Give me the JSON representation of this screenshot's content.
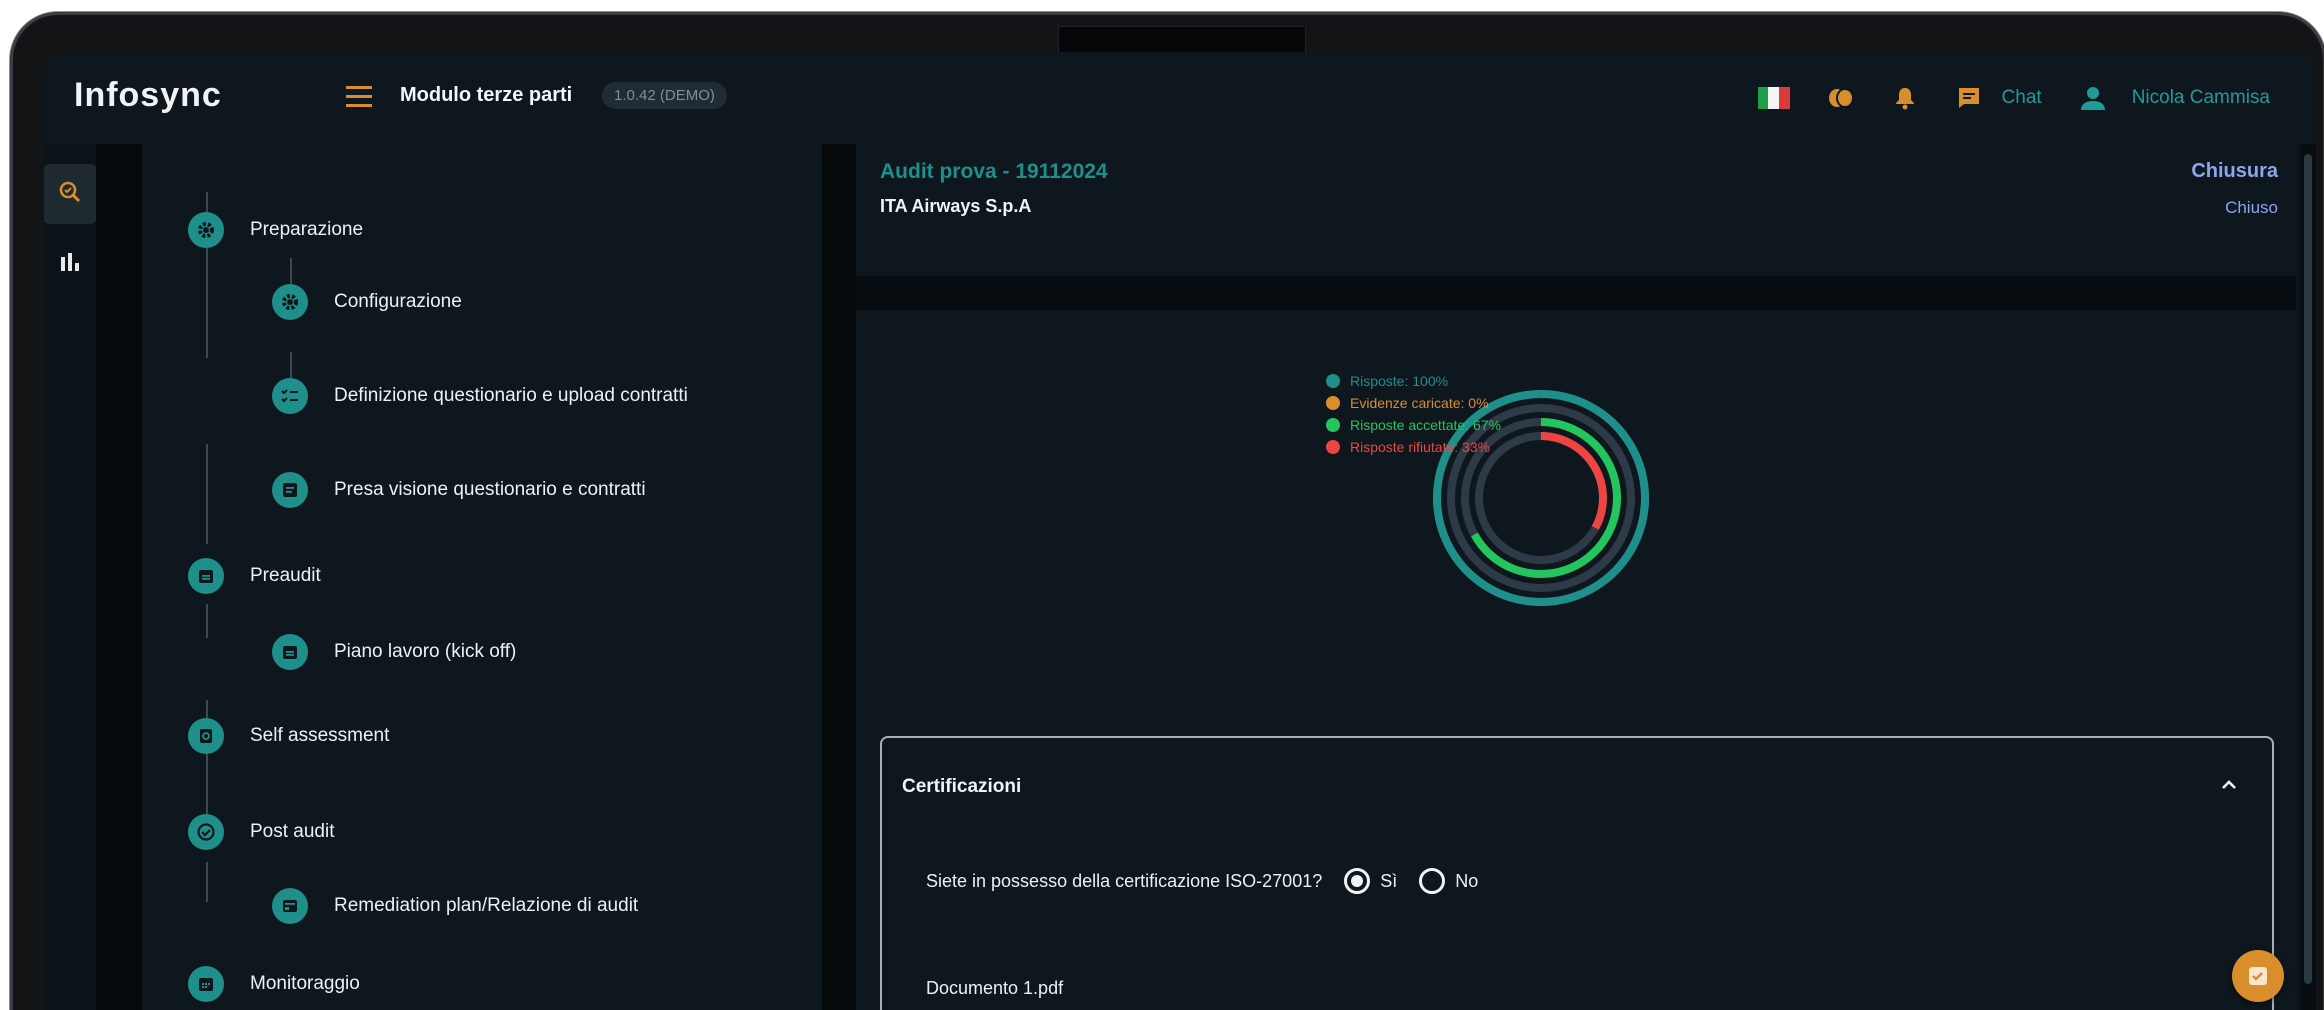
{
  "header": {
    "brand": "Infosync",
    "module_title": "Modulo terze parti",
    "version": "1.0.42 (DEMO)",
    "chat_label": "Chat",
    "user_name": "Nicola Cammisa",
    "accent": "#d98e2b",
    "teal": "#1f9c9a"
  },
  "rail": {
    "items": [
      {
        "icon": "audit-search-icon",
        "active": true
      },
      {
        "icon": "bar-chart-icon",
        "active": false
      }
    ]
  },
  "steps": {
    "items": [
      {
        "label": "Preparazione",
        "icon": "gear-icon",
        "level": 0
      },
      {
        "label": "Configurazione",
        "icon": "gear-icon",
        "level": 1
      },
      {
        "label": "Definizione questionario e upload contratti",
        "icon": "checklist-icon",
        "level": 1
      },
      {
        "label": "Presa visione questionario e contratti",
        "icon": "document-icon",
        "level": 1
      },
      {
        "label": "Preaudit",
        "icon": "calendar-icon",
        "level": 0
      },
      {
        "label": "Piano lavoro (kick off)",
        "icon": "calendar-icon",
        "level": 1
      },
      {
        "label": "Self assessment",
        "icon": "search-doc-icon",
        "level": 0
      },
      {
        "label": "Post audit",
        "icon": "check-circle-icon",
        "level": 0
      },
      {
        "label": "Remediation plan/Relazione di audit",
        "icon": "report-icon",
        "level": 1
      },
      {
        "label": "Monitoraggio",
        "icon": "calendar-grid-icon",
        "level": 0
      }
    ]
  },
  "audit": {
    "title": "Audit prova - 19112024",
    "company": "ITA Airways S.p.A",
    "phase": "Chiusura",
    "status": "Chiuso"
  },
  "chart_data": {
    "type": "radial-bar",
    "series": [
      {
        "name": "Risposte",
        "label": "Risposte: 100%",
        "value": 100,
        "color": "#1f8f8c"
      },
      {
        "name": "Evidenze caricate",
        "label": "Evidenze caricate: 0%",
        "value": 0,
        "color": "#d98e2b"
      },
      {
        "name": "Risposte accettate",
        "label": "Risposte accettate: 67%",
        "value": 67,
        "color": "#22c55e"
      },
      {
        "name": "Risposte rifiutate",
        "label": "Risposte rifiutate: 33%",
        "value": 33,
        "color": "#ef4444"
      }
    ],
    "track_color": "#2e3a48",
    "ylim": [
      0,
      100
    ],
    "legend": "top-left"
  },
  "certificazioni": {
    "title": "Certificazioni",
    "question": "Siete in possesso della certificazione ISO-27001?",
    "options": [
      "Sì",
      "No"
    ],
    "selected": "Sì",
    "document": "Documento 1.pdf"
  }
}
